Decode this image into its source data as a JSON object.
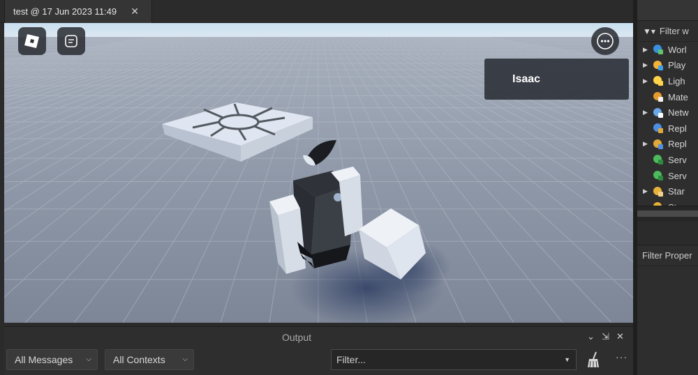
{
  "tab": {
    "title": "test @ 17 Jun 2023 11:49",
    "close": "✕"
  },
  "viewport": {
    "player_name": "Isaac",
    "sky_color": "#c7dcec",
    "ground_color": "#8a93a3"
  },
  "explorer": {
    "filter_label": "Filter w",
    "items": [
      {
        "label": "Worl",
        "icon": "workspace-icon",
        "expandable": true
      },
      {
        "label": "Play",
        "icon": "players-icon",
        "expandable": true
      },
      {
        "label": "Ligh",
        "icon": "lighting-icon",
        "expandable": true
      },
      {
        "label": "Mate",
        "icon": "material-service-icon",
        "expandable": false
      },
      {
        "label": "Netw",
        "icon": "network-client-icon",
        "expandable": true
      },
      {
        "label": "Repl",
        "icon": "replicated-first-icon",
        "expandable": false
      },
      {
        "label": "Repl",
        "icon": "replicated-storage-icon",
        "expandable": true
      },
      {
        "label": "Serv",
        "icon": "server-script-service-icon",
        "expandable": false
      },
      {
        "label": "Serv",
        "icon": "server-storage-icon",
        "expandable": false
      },
      {
        "label": "Star",
        "icon": "starter-gui-icon",
        "expandable": true
      },
      {
        "label": "Star",
        "icon": "starter-pack-icon",
        "expandable": false
      }
    ]
  },
  "properties": {
    "filter_label": "Filter Proper"
  },
  "output": {
    "title": "Output",
    "messages_dropdown": "All Messages",
    "contexts_dropdown": "All Contexts",
    "filter_placeholder": "Filter...",
    "more": "···"
  }
}
